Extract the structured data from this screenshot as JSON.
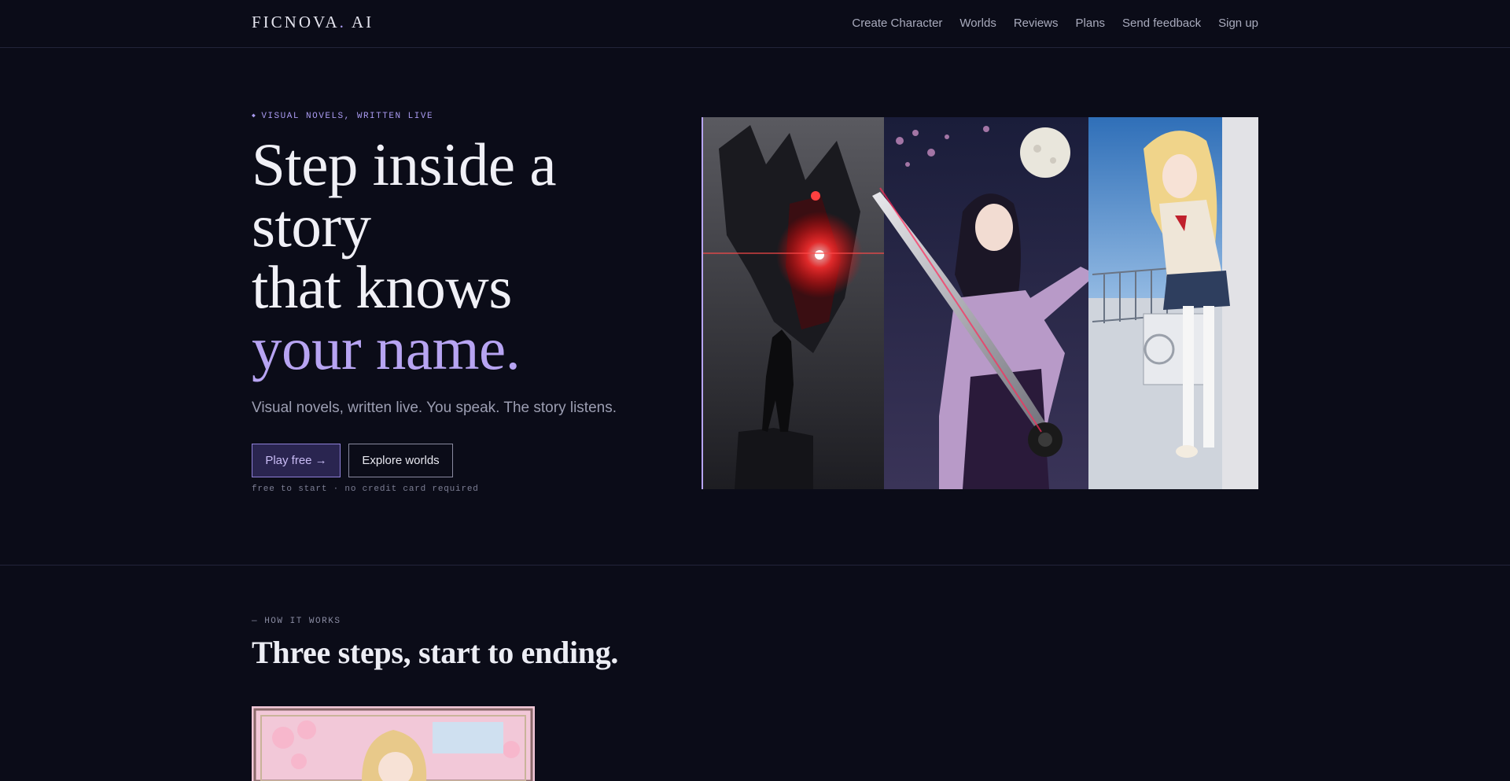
{
  "nav": {
    "logo_main": "FICNOVA",
    "logo_dot": ".",
    "logo_suffix": " AI",
    "links": [
      "Create Character",
      "Worlds",
      "Reviews",
      "Plans",
      "Send feedback",
      "Sign up"
    ]
  },
  "hero": {
    "eyebrow": "VISUAL NOVELS, WRITTEN LIVE",
    "headline_line1": "Step inside a",
    "headline_line2": "story",
    "headline_line3": "that knows",
    "headline_accent": "your name.",
    "subline": "Visual novels, written live. You speak. The story listens.",
    "primary_cta": "Play free →",
    "secondary_cta": "Explore worlds",
    "fine_print": "free to start · no credit card required"
  },
  "how_it_works": {
    "eyebrow": "— HOW IT WORKS",
    "title": "Three steps, start to ending."
  },
  "colors": {
    "background": "#0b0c18",
    "accent": "#b7a4f2",
    "muted_text": "#9c9eb2"
  }
}
